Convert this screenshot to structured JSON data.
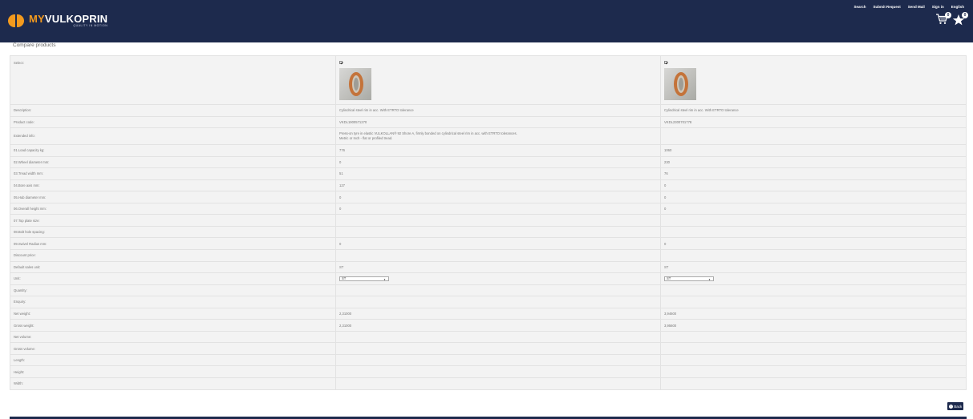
{
  "brand": {
    "prefix": "MY",
    "name": "VULKOPRIN",
    "tagline": "QUALITY IN MOTION"
  },
  "topnav": [
    "Search",
    "Submit Request",
    "Send Mail",
    "Sign in",
    "English"
  ],
  "cart_count": "0",
  "favorites_count": "0",
  "page_title": "Compare products",
  "table": {
    "rows": [
      {
        "label": "Select:",
        "p1": "",
        "p2": ""
      },
      {
        "label": "Description:",
        "p1": "Cylindrical steel rim in acc. With ETRTO tolerance",
        "p2": "Cylindrical steel rim in acc. With ETRTO tolerance"
      },
      {
        "label": "Product code:",
        "p1": "VKDL1900571270",
        "p2": "VKDL2300701778"
      },
      {
        "label": "Extended info:",
        "p1": "Press-on tyre in elastic VULKOLLAN® 92 Shore A, firmly bonded on cylindrical steel rim in acc. with ETRTO tolerances.",
        "p1b": "Metric or Inch - flat or profiled tread.",
        "p2": ""
      },
      {
        "label": "01.Load capacity kg:",
        "p1": "776",
        "p2": "1060"
      },
      {
        "label": "02.Wheel diameter mm:",
        "p1": "0",
        "p2": "230"
      },
      {
        "label": "03.Tread width mm:",
        "p1": "51",
        "p2": "76"
      },
      {
        "label": "04.Bore axis mm:",
        "p1": "127",
        "p2": "0"
      },
      {
        "label": "05.Hub diameter mm:",
        "p1": "0",
        "p2": "0"
      },
      {
        "label": "06.Overall height mm:",
        "p1": "0",
        "p2": "0"
      },
      {
        "label": "07.Top plate size:",
        "p1": "",
        "p2": ""
      },
      {
        "label": "08.Bolt hole spacing:",
        "p1": "",
        "p2": ""
      },
      {
        "label": "09.Swivel Radius mm:",
        "p1": "0",
        "p2": "0"
      },
      {
        "label": "Discount price:",
        "p1": "",
        "p2": ""
      },
      {
        "label": "Default sales unit:",
        "p1": "ST",
        "p2": "ST"
      },
      {
        "label": "Unit:",
        "p1": "ST",
        "p2": "ST"
      },
      {
        "label": "Quantity:",
        "p1": "",
        "p2": ""
      },
      {
        "label": "Enquiry:",
        "p1": "",
        "p2": ""
      },
      {
        "label": "Net weight:",
        "p1": "2,31000",
        "p2": "3,94600"
      },
      {
        "label": "Gross weight:",
        "p1": "2,31000",
        "p2": "3,95600"
      },
      {
        "label": "Net volume:",
        "p1": "",
        "p2": ""
      },
      {
        "label": "Gross volume:",
        "p1": "",
        "p2": ""
      },
      {
        "label": "Length:",
        "p1": "",
        "p2": ""
      },
      {
        "label": "Height:",
        "p1": "",
        "p2": ""
      },
      {
        "label": "Width:",
        "p1": "",
        "p2": ""
      }
    ]
  },
  "back_label": "Back"
}
